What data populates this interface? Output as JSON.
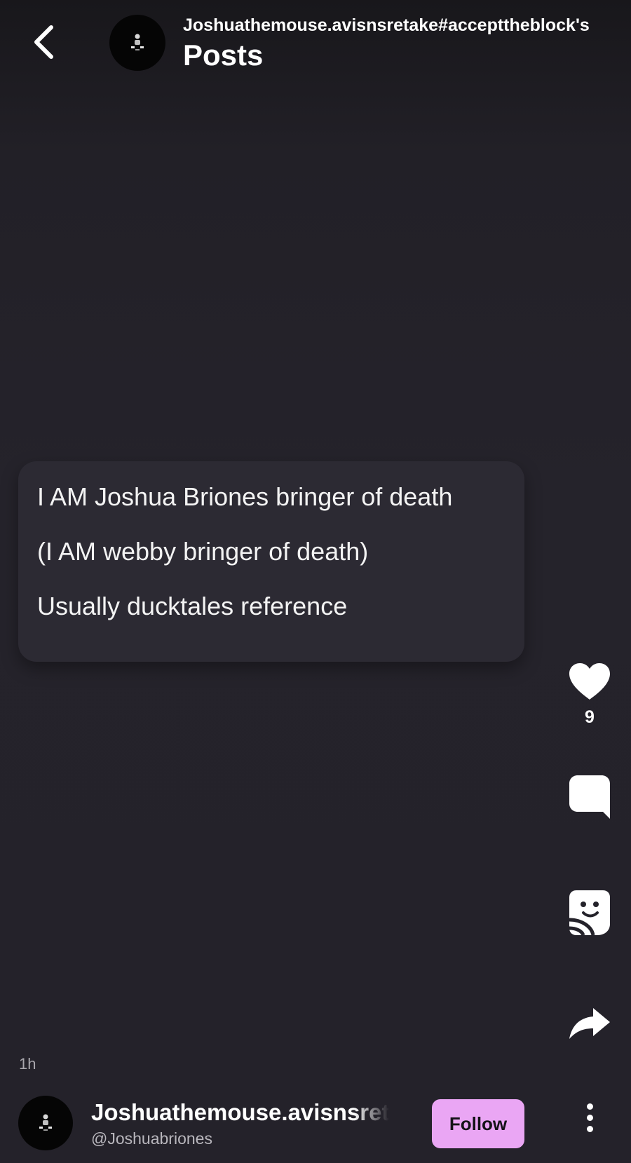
{
  "header": {
    "back_icon": "chevron-left-icon",
    "subtitle": "Joshuathemouse.avisnsretake#accepttheblock's",
    "title": "Posts"
  },
  "post": {
    "lines": [
      "I AM Joshua Briones bringer of death",
      "(I AM webby bringer of death)",
      "Usually ducktales reference"
    ],
    "timestamp": "1h"
  },
  "actions": {
    "like": {
      "icon": "heart-icon",
      "count": "9"
    },
    "comment": {
      "icon": "comment-bubble-icon"
    },
    "sticker": {
      "icon": "sticker-icon"
    },
    "share": {
      "icon": "share-arrow-icon"
    }
  },
  "author": {
    "name": "Joshuathemouse.avisnsretake#accepttheblock",
    "handle": "@Joshuabriones",
    "follow_label": "Follow",
    "more_icon": "more-vertical-icon"
  },
  "colors": {
    "background": "#24222a",
    "card": "#2c2a33",
    "follow_button": "#eaa6f4"
  }
}
